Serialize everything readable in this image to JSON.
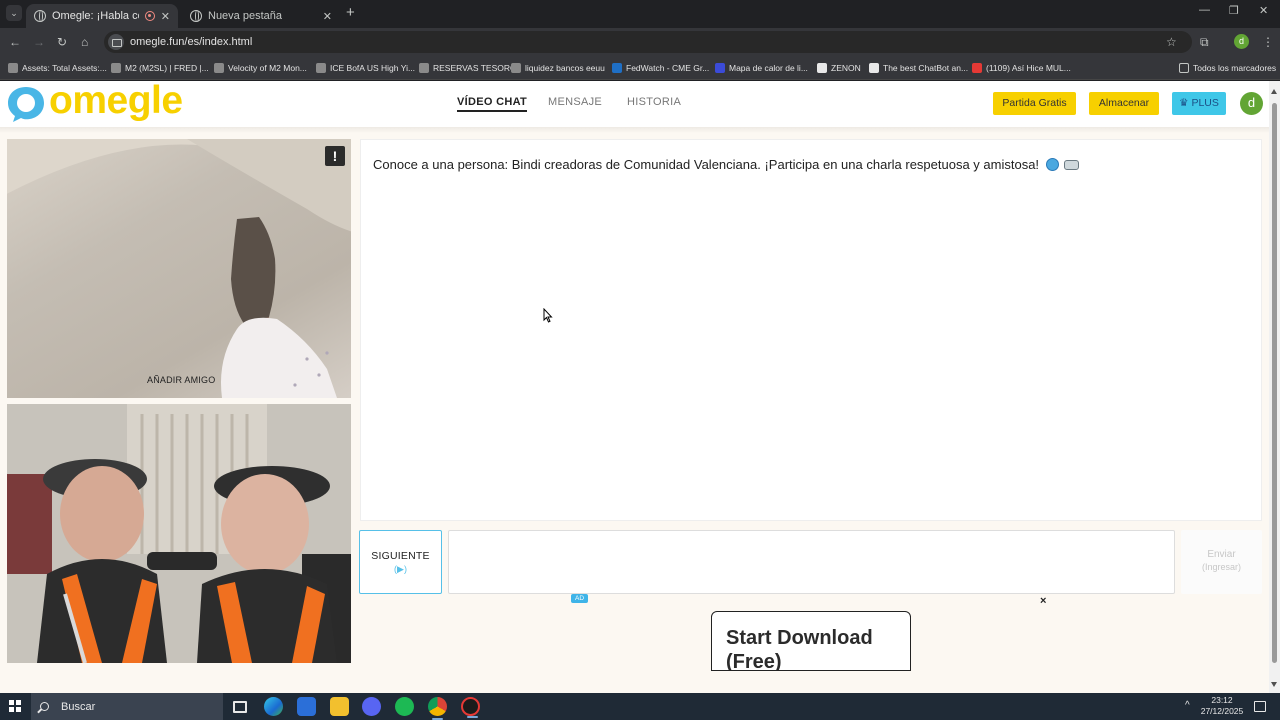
{
  "browser": {
    "tabs": [
      {
        "title": "Omegle: ¡Habla con Descon",
        "active": true
      },
      {
        "title": "Nueva pestaña",
        "active": false
      }
    ],
    "url": "omegle.fun/es/index.html",
    "profile_initial": "d",
    "bookmarks": [
      {
        "label": "Assets: Total Assets:...",
        "color": "#8a8a8a"
      },
      {
        "label": "M2 (M2SL) | FRED |...",
        "color": "#8a8a8a"
      },
      {
        "label": "Velocity of M2 Mon...",
        "color": "#8a8a8a"
      },
      {
        "label": "ICE BofA US High Yi...",
        "color": "#8a8a8a"
      },
      {
        "label": "RESERVAS TESORO",
        "color": "#8a8a8a"
      },
      {
        "label": "liquidez bancos eeuu",
        "color": "#8a8a8a"
      },
      {
        "label": "FedWatch - CME Gr...",
        "color": "#1f6fc5"
      },
      {
        "label": "Mapa de calor de li...",
        "color": "#3b4bd8"
      },
      {
        "label": "ZENON",
        "color": "#e8e8e8"
      },
      {
        "label": "The best ChatBot an...",
        "color": "#e8e8e8"
      },
      {
        "label": "(1109) Así Hice MUL...",
        "color": "#e53935"
      }
    ],
    "all_bookmarks_label": "Todos los marcadores"
  },
  "site": {
    "logo_text": "omegle",
    "logo_color": "#f7d000",
    "nav": [
      {
        "label": "VÍDEO CHAT",
        "active": true
      },
      {
        "label": "MENSAJE",
        "active": false
      },
      {
        "label": "HISTORIA",
        "active": false
      }
    ],
    "buttons": {
      "free_game": "Partida Gratis",
      "store": "Almacenar",
      "plus": "PLUS"
    },
    "avatar_initial": "d"
  },
  "video": {
    "add_friend_label": "AÑADIR AMIGO",
    "report_icon": "!"
  },
  "chat": {
    "message": "Conoce a una persona: Bindi creadoras de Comunidad Valenciana. ¡Participa en una charla respetuosa y amistosa!",
    "next_label": "SIGUIENTE",
    "next_sub": "(▶)",
    "input_value": "",
    "send_label": "Enviar",
    "send_sub": "(Ingresar)"
  },
  "ad": {
    "badge": "AD",
    "close": "×",
    "text": "Start Download (Free)"
  },
  "taskbar": {
    "search_label": "Buscar",
    "time": "23:12",
    "date": "27/12/2025"
  }
}
